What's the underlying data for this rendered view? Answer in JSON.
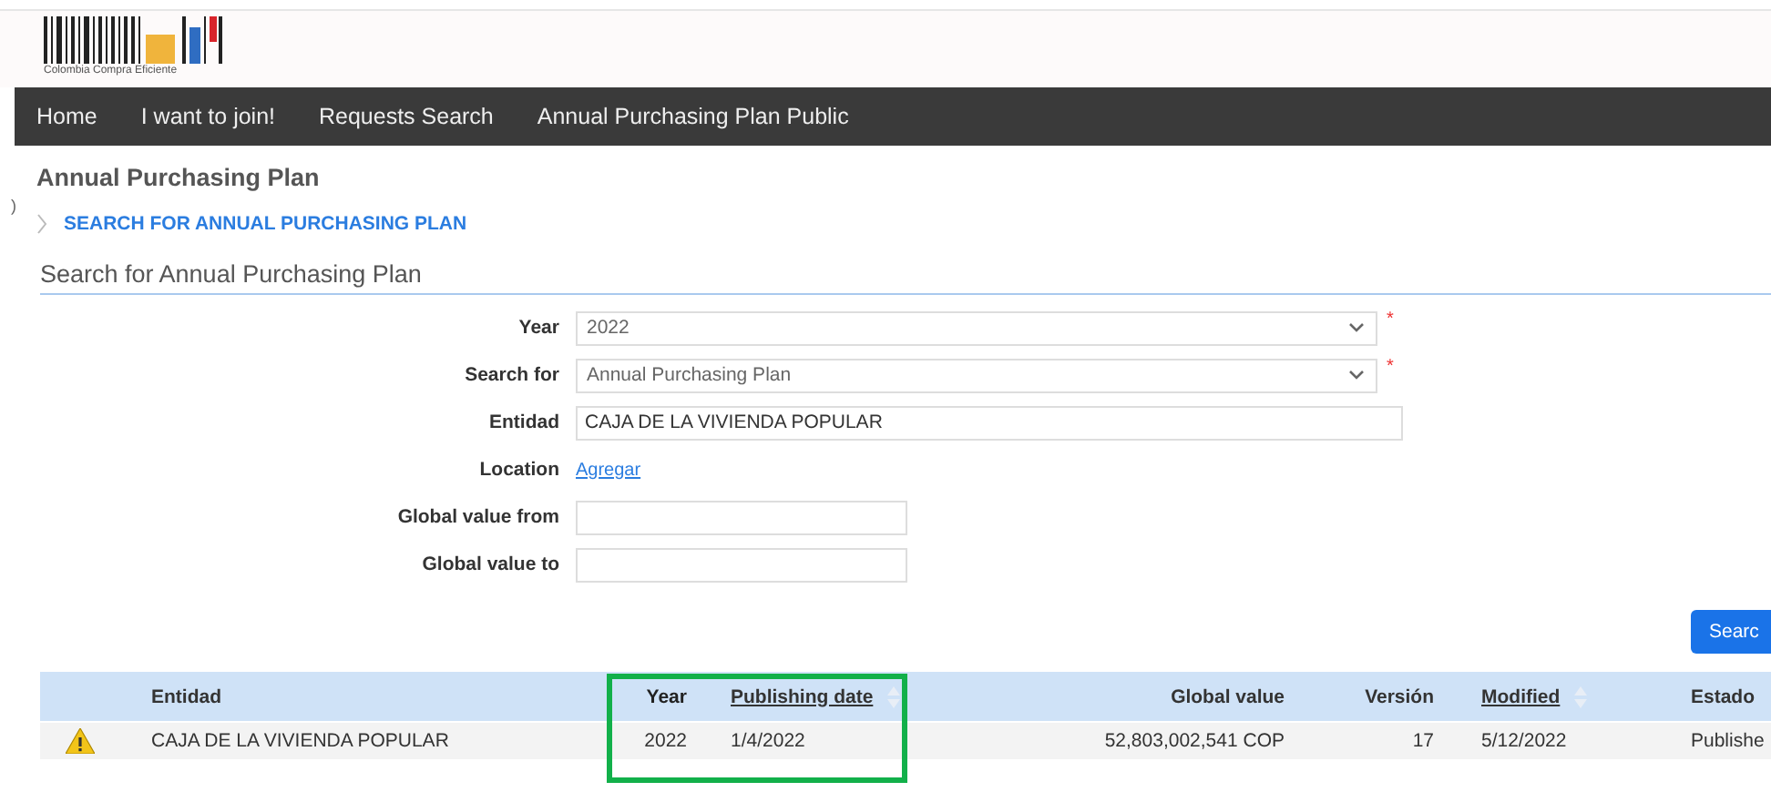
{
  "logo": {
    "caption": "Colombia Compra Eficiente"
  },
  "nav": [
    {
      "label": "Home"
    },
    {
      "label": "I want to join!"
    },
    {
      "label": "Requests Search"
    },
    {
      "label": "Annual Purchasing Plan Public"
    }
  ],
  "page_title": "Annual Purchasing Plan",
  "breadcrumb": "SEARCH FOR ANNUAL PURCHASING PLAN",
  "side_mark": ")",
  "section_title": "Search for Annual Purchasing Plan",
  "form": [
    {
      "kind": "select",
      "label": "Year",
      "value": "2022",
      "required_mark": "*"
    },
    {
      "kind": "select",
      "label": "Search for",
      "value": "Annual Purchasing Plan",
      "required_mark": "*"
    },
    {
      "kind": "text",
      "label": "Entidad",
      "value": "CAJA DE LA VIVIENDA POPULAR"
    },
    {
      "kind": "link",
      "label": "Location",
      "value": "Agregar"
    },
    {
      "kind": "short",
      "label": "Global value from"
    },
    {
      "kind": "short",
      "label": "Global value to"
    }
  ],
  "search_button": "Searc",
  "table": {
    "columns": [
      {
        "label": "Entidad",
        "sortable": false,
        "highlighted": false
      },
      {
        "label": "Year",
        "sortable": false,
        "highlighted": true
      },
      {
        "label": "Publishing date",
        "sortable": true,
        "highlighted": true
      },
      {
        "label": "Global value",
        "sortable": false,
        "highlighted": false
      },
      {
        "label": "Versión",
        "sortable": false,
        "highlighted": false
      },
      {
        "label": "Modified",
        "sortable": true,
        "highlighted": false
      },
      {
        "label": "Estado",
        "sortable": false,
        "highlighted": false
      }
    ],
    "rows": [
      {
        "warning": true,
        "cells": [
          "CAJA DE LA VIVIENDA POPULAR",
          "2022",
          "1/4/2022",
          "52,803,002,541 COP",
          "17",
          "5/12/2022",
          "Publishe"
        ]
      }
    ]
  }
}
